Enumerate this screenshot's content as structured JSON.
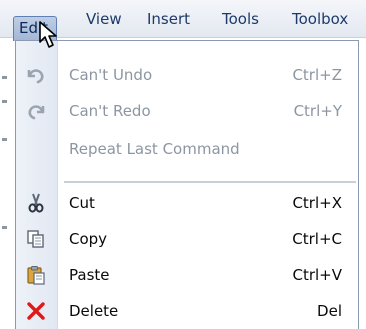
{
  "menubar": {
    "items": [
      {
        "label": "Edit",
        "active": true
      },
      {
        "label": "View",
        "active": false
      },
      {
        "label": "Insert",
        "active": false
      },
      {
        "label": "Tools",
        "active": false
      },
      {
        "label": "Toolbox",
        "active": false
      }
    ]
  },
  "edit_menu": {
    "items": [
      {
        "label": "Can't Undo",
        "shortcut": "Ctrl+Z",
        "icon": "undo-icon",
        "enabled": false
      },
      {
        "label": "Can't Redo",
        "shortcut": "Ctrl+Y",
        "icon": "redo-icon",
        "enabled": false
      },
      {
        "label": "Repeat Last Command",
        "shortcut": "",
        "icon": "",
        "enabled": false
      },
      {
        "label": "Cut",
        "shortcut": "Ctrl+X",
        "icon": "scissors-icon",
        "enabled": true
      },
      {
        "label": "Copy",
        "shortcut": "Ctrl+C",
        "icon": "copy-icon",
        "enabled": true
      },
      {
        "label": "Paste",
        "shortcut": "Ctrl+V",
        "icon": "paste-icon",
        "enabled": true
      },
      {
        "label": "Delete",
        "shortcut": "Del",
        "icon": "delete-icon",
        "enabled": true
      }
    ]
  },
  "colors": {
    "menu_text": "#1e3a6a",
    "disabled_text": "#8c96a2",
    "enabled_text": "#0a0a0a",
    "active_highlight": "#a3b6d6",
    "delete_red": "#e01818"
  }
}
